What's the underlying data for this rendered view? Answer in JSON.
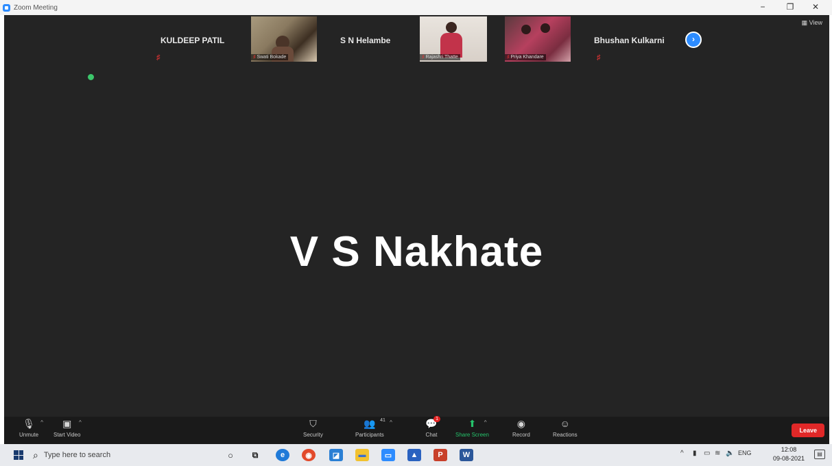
{
  "window": {
    "title": "Zoom Meeting",
    "controls": {
      "minimize": "−",
      "maximize": "❐",
      "close": "✕"
    }
  },
  "meeting": {
    "view_label": "View",
    "active_speaker": "V S Nakhate",
    "participants": [
      {
        "name": "KULDEEP PATIL",
        "muted": true,
        "video": false
      },
      {
        "name": "Swati Bokade",
        "muted": true,
        "video": true
      },
      {
        "name": "S N Helambe",
        "muted": false,
        "video": false
      },
      {
        "name": "Rajashri Thatte",
        "muted": true,
        "video": true
      },
      {
        "name": "Priya Khandare",
        "muted": true,
        "video": true
      },
      {
        "name": "Bhushan Kulkarni",
        "muted": true,
        "video": false
      }
    ],
    "next_page_icon": "chevron-right-icon"
  },
  "controls": {
    "unmute": "Unmute",
    "start_video": "Start Video",
    "security": "Security",
    "participants": "Participants",
    "participants_count": "41",
    "chat": "Chat",
    "chat_badge": "1",
    "share_screen": "Share Screen",
    "record": "Record",
    "reactions": "Reactions",
    "leave": "Leave"
  },
  "taskbar": {
    "search_placeholder": "Type here to search",
    "language": "ENG",
    "time": "12:08",
    "date": "09-08-2021"
  },
  "colors": {
    "meeting_bg": "#242424",
    "accent": "#2d8cff",
    "leave": "#e02828",
    "share": "#25c26b"
  }
}
